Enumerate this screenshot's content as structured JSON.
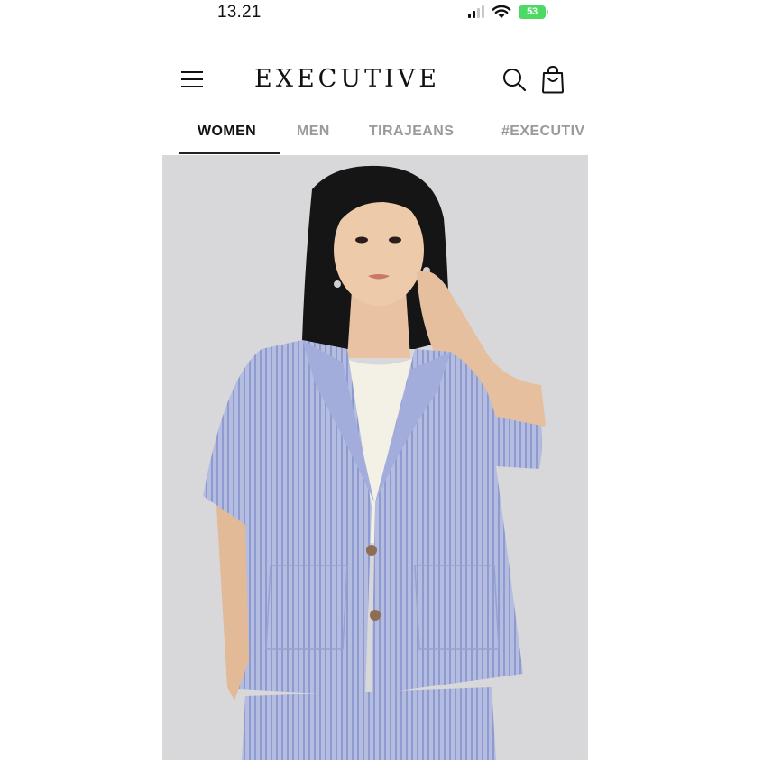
{
  "status_bar": {
    "time": "13.21",
    "battery": "53",
    "icons": [
      "signal-icon",
      "wifi-icon",
      "battery-charging-icon"
    ]
  },
  "header": {
    "brand": "EXECUTIVE",
    "icons": [
      "hamburger-menu-icon",
      "search-icon",
      "shopping-bag-icon"
    ]
  },
  "tabs": [
    {
      "label": "WOMEN",
      "active": true
    },
    {
      "label": "MEN",
      "active": false
    },
    {
      "label": "TIRAJEANS",
      "active": false
    },
    {
      "label": "#EXECUTIV",
      "active": false
    }
  ],
  "hero": {
    "content": "model-photo"
  },
  "colors": {
    "text": "#111111",
    "inactive_tab": "#9a9a9a",
    "battery": "#4cd964",
    "hero_background": "#d8d8da",
    "jacket": "#aeb8dc"
  }
}
